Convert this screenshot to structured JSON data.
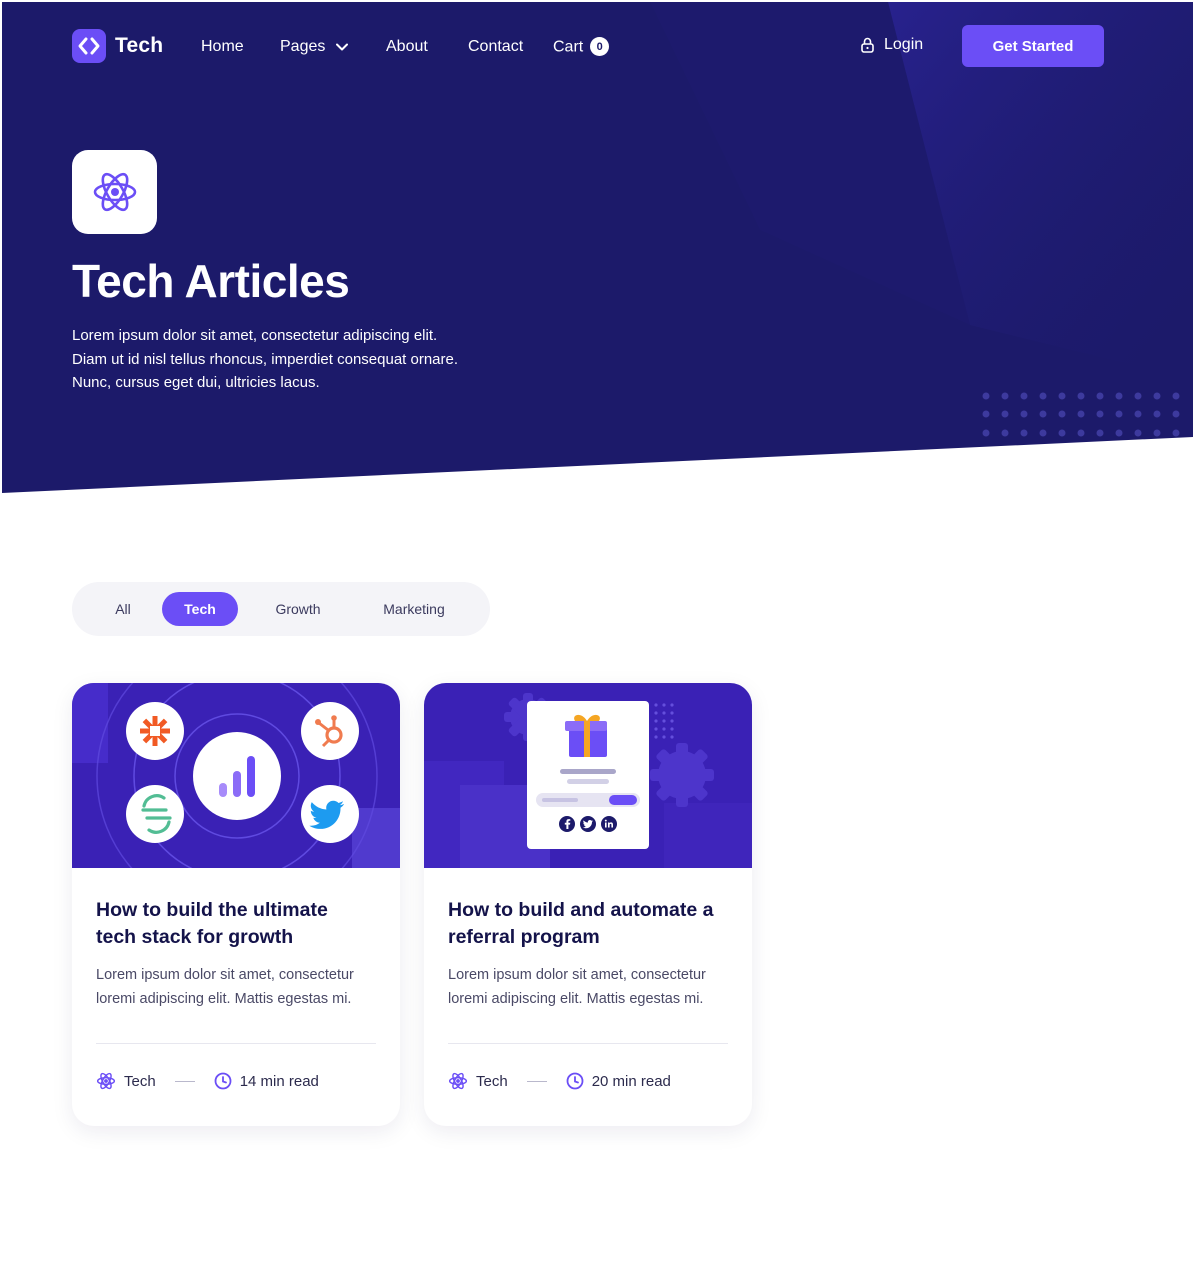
{
  "colors": {
    "hero_background": "#1c1a6a",
    "accent": "#6b4ef6",
    "title": "#14134a",
    "body_text": "#4a4966"
  },
  "nav": {
    "brand": "Tech",
    "links": [
      "Home",
      "Pages",
      "About",
      "Contact",
      "Cart"
    ],
    "cart_count": "0",
    "login": "Login",
    "cta": "Get Started"
  },
  "hero": {
    "icon": "atom-icon",
    "title": "Tech Articles",
    "description_lines": [
      "Lorem ipsum dolor sit amet, consectetur adipiscing elit.",
      "Diam ut id nisl tellus rhoncus, imperdiet consequat ornare.",
      "Nunc, cursus eget dui, ultricies lacus."
    ]
  },
  "filters": {
    "tabs": [
      "All",
      "Tech",
      "Growth",
      "Marketing"
    ],
    "active": "Tech"
  },
  "articles": [
    {
      "title_lines": [
        "How to build the ultimate",
        "tech stack for growth"
      ],
      "excerpt_lines": [
        "Lorem ipsum dolor sit amet, consectetur",
        "loremi adipiscing elit. Mattis egestas mi."
      ],
      "category": "Tech",
      "read_time": "14 min read",
      "image_icons": [
        "zapier-icon",
        "hubspot-icon",
        "bar-chart-icon",
        "segment-icon",
        "twitter-icon"
      ]
    },
    {
      "title_lines": [
        "How to build and automate a",
        "referral program"
      ],
      "excerpt_lines": [
        "Lorem ipsum dolor sit amet, consectetur",
        "loremi adipiscing elit. Mattis egestas mi."
      ],
      "category": "Tech",
      "read_time": "20 min read",
      "image_icons": [
        "gift-icon",
        "facebook-icon",
        "twitter-icon",
        "linkedin-icon",
        "gear-icon"
      ]
    }
  ]
}
